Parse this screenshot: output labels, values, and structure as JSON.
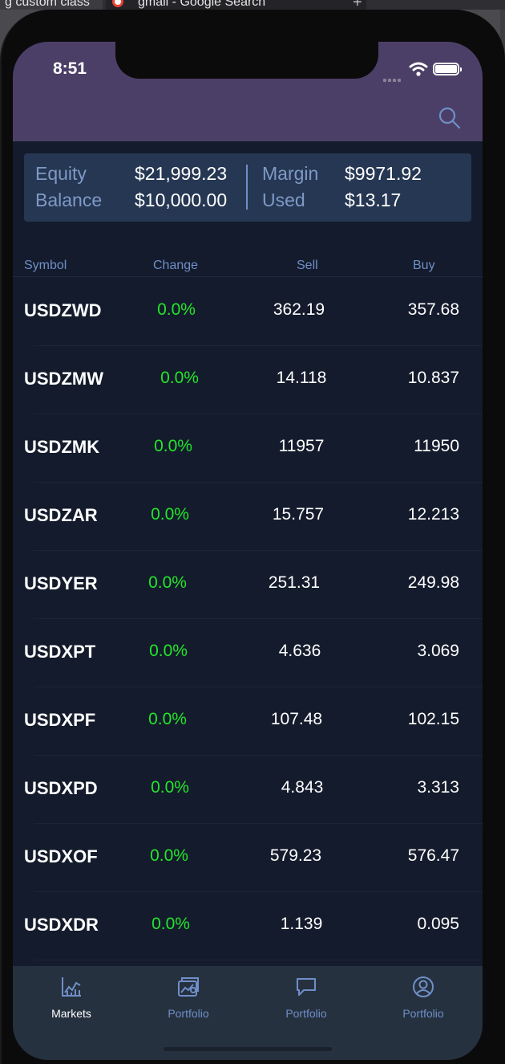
{
  "browser": {
    "tabs": [
      {
        "label": "g custom class"
      },
      {
        "label": "gmail - Google Search"
      }
    ],
    "new_tab_symbol": "+"
  },
  "status_bar": {
    "time": "8:51",
    "icons": [
      "cellular-signal-icon",
      "wifi-icon",
      "battery-icon"
    ]
  },
  "header": {
    "background_color": "#4c3f67",
    "search_icon": "search-icon"
  },
  "account_summary": {
    "equity_label": "Equity",
    "equity_value": "$21,999.23",
    "balance_label": "Balance",
    "balance_value": "$10,000.00",
    "margin_label": "Margin",
    "margin_value": "$9971.92",
    "used_label": "Used",
    "used_value": "$13.17"
  },
  "table": {
    "columns": {
      "symbol": "Symbol",
      "change": "Change",
      "sell": "Sell",
      "buy": "Buy"
    },
    "rows": [
      {
        "symbol": "USDZWD",
        "change": "0.0%",
        "sell": "362.19",
        "buy": "357.68"
      },
      {
        "symbol": "USDZMW",
        "change": "0.0%",
        "sell": "14.118",
        "buy": "10.837"
      },
      {
        "symbol": "USDZMK",
        "change": "0.0%",
        "sell": "11957",
        "buy": "11950"
      },
      {
        "symbol": "USDZAR",
        "change": "0.0%",
        "sell": "15.757",
        "buy": "12.213"
      },
      {
        "symbol": "USDYER",
        "change": "0.0%",
        "sell": "251.31",
        "buy": "249.98"
      },
      {
        "symbol": "USDXPT",
        "change": "0.0%",
        "sell": "4.636",
        "buy": "3.069"
      },
      {
        "symbol": "USDXPF",
        "change": "0.0%",
        "sell": "107.48",
        "buy": "102.15"
      },
      {
        "symbol": "USDXPD",
        "change": "0.0%",
        "sell": "4.843",
        "buy": "3.313"
      },
      {
        "symbol": "USDXOF",
        "change": "0.0%",
        "sell": "579.23",
        "buy": "576.47"
      },
      {
        "symbol": "USDXDR",
        "change": "0.0%",
        "sell": "1.139",
        "buy": "0.095"
      }
    ]
  },
  "tab_bar": {
    "items": [
      {
        "label": "Markets",
        "icon": "chart-icon",
        "active": true
      },
      {
        "label": "Portfolio",
        "icon": "portfolio-chart-icon",
        "active": false
      },
      {
        "label": "Portfolio",
        "icon": "chat-icon",
        "active": false
      },
      {
        "label": "Portfolio",
        "icon": "user-icon",
        "active": false
      }
    ],
    "active_color": "#ffffff",
    "inactive_color": "#6f8fc7"
  },
  "colors": {
    "change_positive": "#22e62a",
    "label_blue": "#7f99c6",
    "screen_background": "#141b2c",
    "card_background": "#263753"
  }
}
